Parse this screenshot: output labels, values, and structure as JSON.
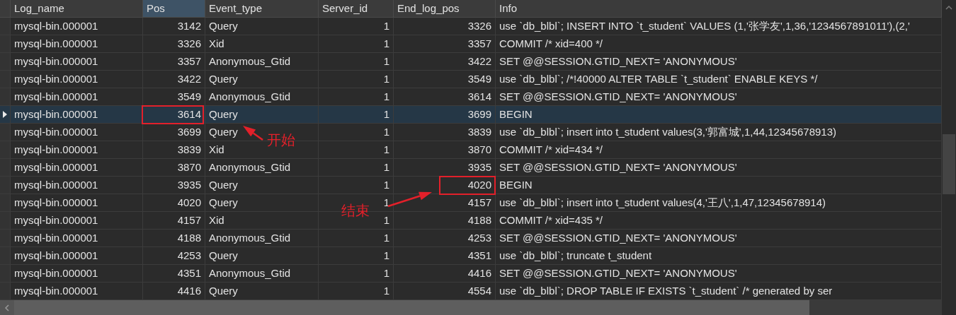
{
  "table": {
    "columns": [
      {
        "label": "Log_name",
        "selected": false
      },
      {
        "label": "Pos",
        "selected": true
      },
      {
        "label": "Event_type",
        "selected": false
      },
      {
        "label": "Server_id",
        "selected": false
      },
      {
        "label": "End_log_pos",
        "selected": false
      },
      {
        "label": "Info",
        "selected": false
      }
    ],
    "rows": [
      {
        "selected": false,
        "cells": [
          "mysql-bin.000001",
          "3142",
          "Query",
          "1",
          "3326",
          "use `db_blbl`; INSERT INTO `t_student` VALUES (1,'张学友',1,36,'1234567891011'),(2,'"
        ]
      },
      {
        "selected": false,
        "cells": [
          "mysql-bin.000001",
          "3326",
          "Xid",
          "1",
          "3357",
          "COMMIT /* xid=400 */"
        ]
      },
      {
        "selected": false,
        "cells": [
          "mysql-bin.000001",
          "3357",
          "Anonymous_Gtid",
          "1",
          "3422",
          "SET @@SESSION.GTID_NEXT= 'ANONYMOUS'"
        ]
      },
      {
        "selected": false,
        "cells": [
          "mysql-bin.000001",
          "3422",
          "Query",
          "1",
          "3549",
          "use `db_blbl`; /*!40000 ALTER TABLE `t_student` ENABLE KEYS */"
        ]
      },
      {
        "selected": false,
        "cells": [
          "mysql-bin.000001",
          "3549",
          "Anonymous_Gtid",
          "1",
          "3614",
          "SET @@SESSION.GTID_NEXT= 'ANONYMOUS'"
        ]
      },
      {
        "selected": true,
        "cells": [
          "mysql-bin.000001",
          "3614",
          "Query",
          "1",
          "3699",
          "BEGIN"
        ]
      },
      {
        "selected": false,
        "cells": [
          "mysql-bin.000001",
          "3699",
          "Query",
          "1",
          "3839",
          "use `db_blbl`; insert into t_student values(3,'郭富城',1,44,12345678913)"
        ]
      },
      {
        "selected": false,
        "cells": [
          "mysql-bin.000001",
          "3839",
          "Xid",
          "1",
          "3870",
          "COMMIT /* xid=434 */"
        ]
      },
      {
        "selected": false,
        "cells": [
          "mysql-bin.000001",
          "3870",
          "Anonymous_Gtid",
          "1",
          "3935",
          "SET @@SESSION.GTID_NEXT= 'ANONYMOUS'"
        ]
      },
      {
        "selected": false,
        "cells": [
          "mysql-bin.000001",
          "3935",
          "Query",
          "1",
          "4020",
          "BEGIN"
        ]
      },
      {
        "selected": false,
        "cells": [
          "mysql-bin.000001",
          "4020",
          "Query",
          "1",
          "4157",
          "use `db_blbl`; insert into t_student values(4,'王八',1,47,12345678914)"
        ]
      },
      {
        "selected": false,
        "cells": [
          "mysql-bin.000001",
          "4157",
          "Xid",
          "1",
          "4188",
          "COMMIT /* xid=435 */"
        ]
      },
      {
        "selected": false,
        "cells": [
          "mysql-bin.000001",
          "4188",
          "Anonymous_Gtid",
          "1",
          "4253",
          "SET @@SESSION.GTID_NEXT= 'ANONYMOUS'"
        ]
      },
      {
        "selected": false,
        "cells": [
          "mysql-bin.000001",
          "4253",
          "Query",
          "1",
          "4351",
          "use `db_blbl`; truncate t_student"
        ]
      },
      {
        "selected": false,
        "cells": [
          "mysql-bin.000001",
          "4351",
          "Anonymous_Gtid",
          "1",
          "4416",
          "SET @@SESSION.GTID_NEXT= 'ANONYMOUS'"
        ]
      },
      {
        "selected": false,
        "cells": [
          "mysql-bin.000001",
          "4416",
          "Query",
          "1",
          "4554",
          "use `db_blbl`; DROP TABLE IF EXISTS `t_student` /* generated by ser"
        ]
      }
    ]
  },
  "annotations": [
    {
      "kind": "start",
      "label": "开始"
    },
    {
      "kind": "end",
      "label": "结束"
    }
  ]
}
